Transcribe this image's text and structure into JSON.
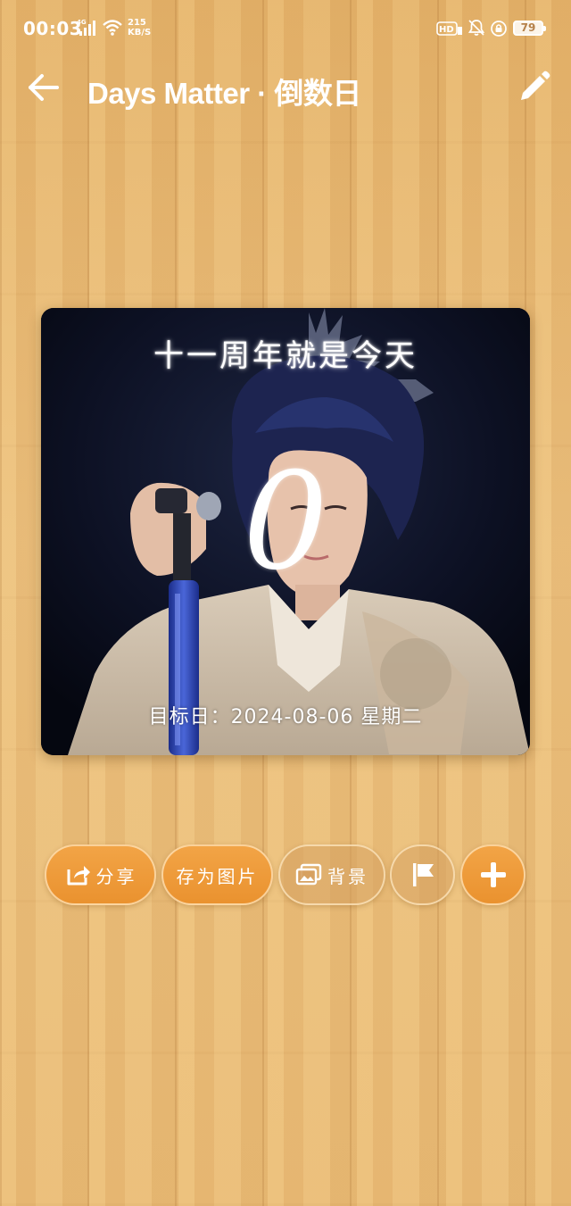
{
  "status_bar": {
    "time": "00:03",
    "network_type": "4G",
    "speed_value": "215",
    "speed_unit": "KB/S",
    "hd_label": "HD",
    "battery": "79"
  },
  "app_bar": {
    "title": "Days Matter · 倒数日",
    "back_icon": "arrow-left-icon",
    "edit_icon": "pencil-icon"
  },
  "card": {
    "title": "十一周年就是今天",
    "days": "0",
    "target_date": "目标日：2024-08-06 星期二"
  },
  "actions": {
    "share_label": "分享",
    "save_image_label": "存为图片",
    "background_label": "背景",
    "flag_icon": "flag-icon",
    "add_icon": "plus-icon"
  },
  "colors": {
    "button_orange": "#f0a040",
    "wood_base": "#e6b56e",
    "text_white": "#ffffff"
  }
}
